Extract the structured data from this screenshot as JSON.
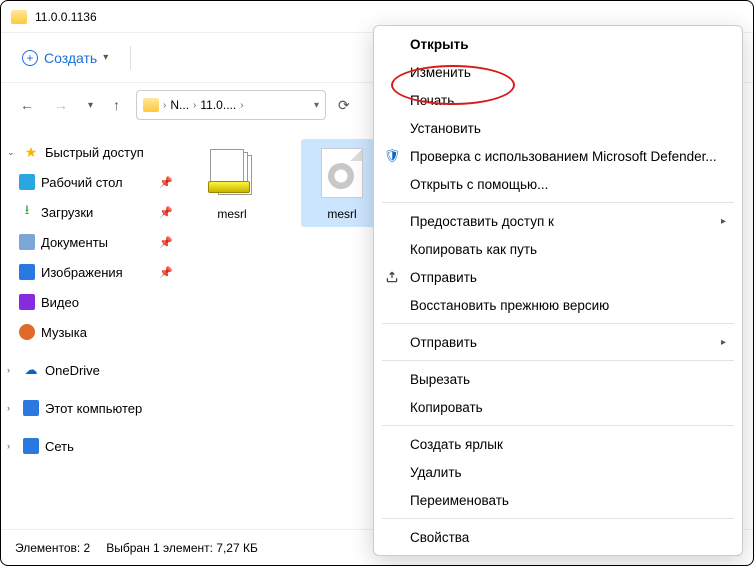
{
  "window": {
    "title": "11.0.0.1136"
  },
  "toolbar": {
    "create_label": "Создать"
  },
  "breadcrumb": {
    "seg1": "N...",
    "seg2": "11.0...."
  },
  "sidebar": {
    "quick": "Быстрый доступ",
    "desktop": "Рабочий стол",
    "downloads": "Загрузки",
    "documents": "Документы",
    "pictures": "Изображения",
    "video": "Видео",
    "music": "Музыка",
    "onedrive": "OneDrive",
    "thispc": "Этот компьютер",
    "network": "Сеть"
  },
  "files": {
    "file1": "mesrl",
    "file2": "mesrl"
  },
  "status": {
    "elements": "Элементов: 2",
    "selected": "Выбран 1 элемент: 7,27 КБ"
  },
  "context": {
    "open": "Открыть",
    "edit": "Изменить",
    "print": "Печать",
    "install": "Установить",
    "defender": "Проверка с использованием Microsoft Defender...",
    "open_with": "Открыть с помощью...",
    "give_access": "Предоставить доступ к",
    "copy_path": "Копировать как путь",
    "send": "Отправить",
    "restore": "Восстановить прежнюю версию",
    "send2": "Отправить",
    "cut": "Вырезать",
    "copy": "Копировать",
    "shortcut": "Создать ярлык",
    "delete": "Удалить",
    "rename": "Переименовать",
    "properties": "Свойства"
  }
}
